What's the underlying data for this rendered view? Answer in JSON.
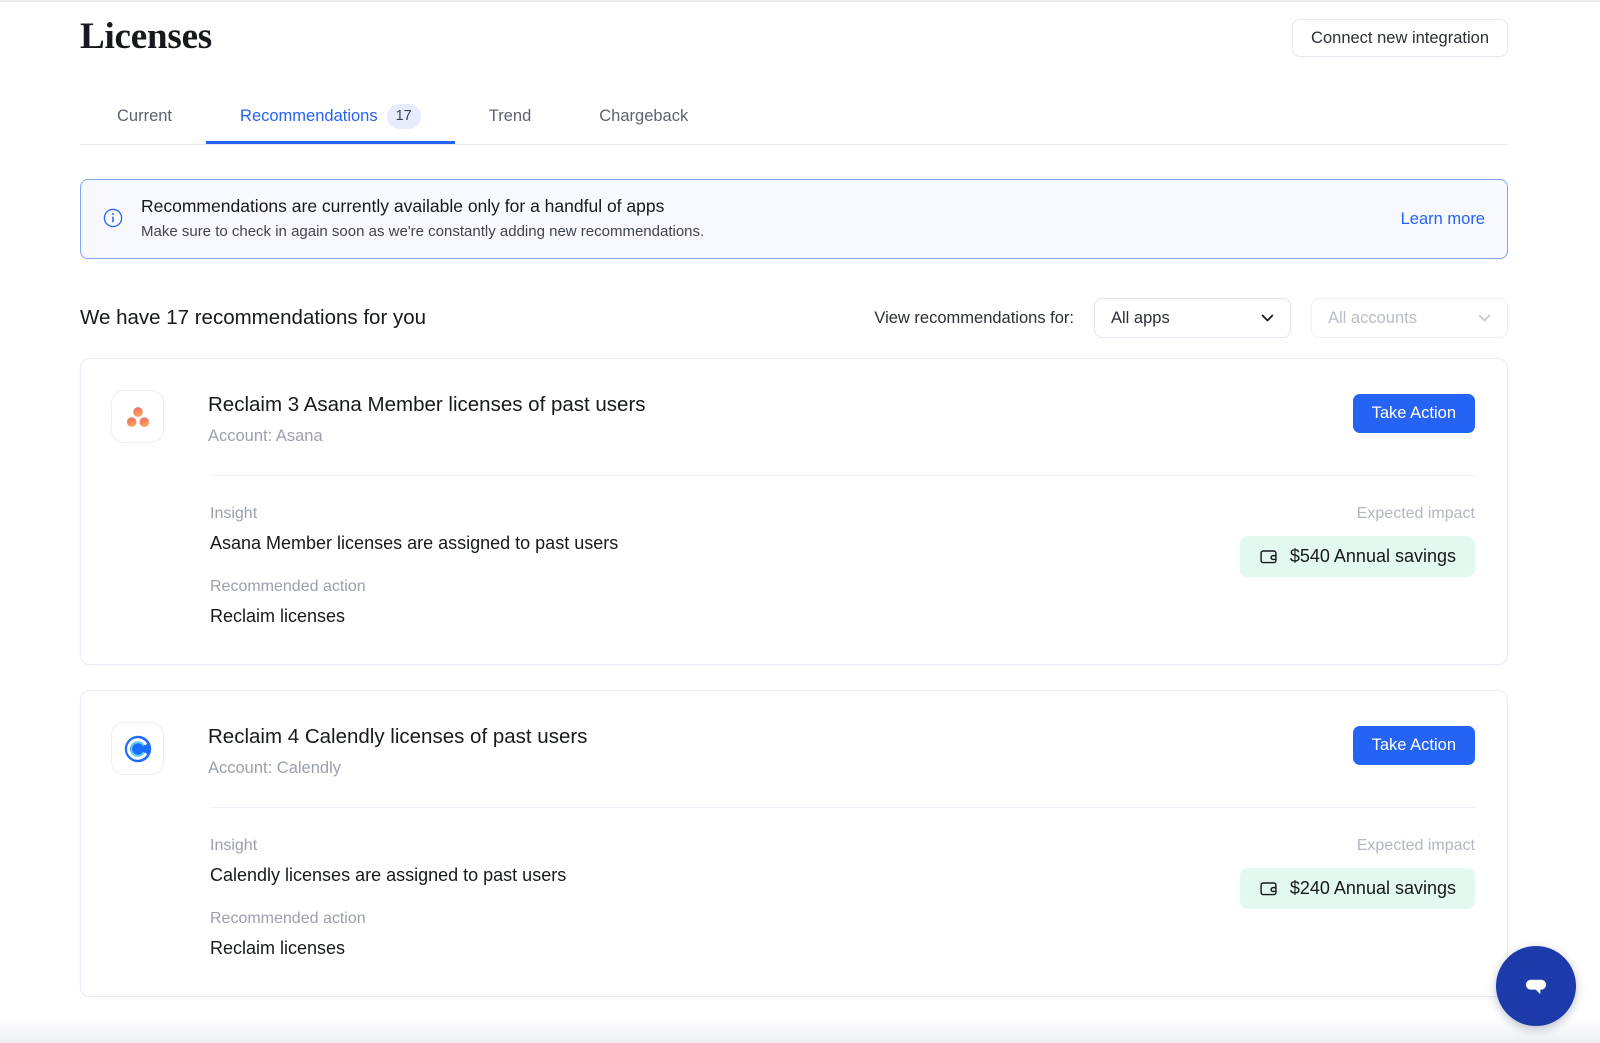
{
  "header": {
    "title": "Licenses",
    "connect_button": "Connect new integration"
  },
  "tabs": [
    {
      "label": "Current",
      "badge": null,
      "active": false
    },
    {
      "label": "Recommendations",
      "badge": "17",
      "active": true
    },
    {
      "label": "Trend",
      "badge": null,
      "active": false
    },
    {
      "label": "Chargeback",
      "badge": null,
      "active": false
    }
  ],
  "banner": {
    "icon": "info-circle-icon",
    "title": "Recommendations are currently available only for a handful of apps",
    "subtitle": "Make sure to check in again soon as we're constantly adding new recommendations.",
    "link": "Learn more"
  },
  "filters": {
    "count_text": "We have 17 recommendations for you",
    "label": "View recommendations for:",
    "apps_select": {
      "value": "All apps",
      "icon": "chevron-down-icon",
      "disabled": false
    },
    "accounts_select": {
      "placeholder": "All accounts",
      "icon": "chevron-down-icon",
      "disabled": true
    }
  },
  "labels": {
    "insight": "Insight",
    "recommended_action": "Recommended action",
    "expected_impact": "Expected impact",
    "take_action": "Take Action"
  },
  "recommendations": [
    {
      "app_icon": "asana-logo-icon",
      "title": "Reclaim 3 Asana Member licenses of past users",
      "account": "Account: Asana",
      "insight": "Asana Member licenses are assigned to past users",
      "action": "Reclaim licenses",
      "savings": "$540 Annual savings",
      "savings_icon": "wallet-icon"
    },
    {
      "app_icon": "calendly-logo-icon",
      "title": "Reclaim 4 Calendly licenses of past users",
      "account": "Account: Calendly",
      "insight": "Calendly licenses are assigned to past users",
      "action": "Reclaim licenses",
      "savings": "$240 Annual savings",
      "savings_icon": "wallet-icon"
    }
  ],
  "chat": {
    "icon": "chat-bubble-icon"
  },
  "colors": {
    "accent_blue": "#2563f5",
    "banner_border": "#7fa3f7",
    "banner_bg": "#f7f9ff",
    "savings_bg": "#e3f8ee",
    "chat_bg": "#1c3aa9",
    "muted_text": "#9aa0ad"
  }
}
